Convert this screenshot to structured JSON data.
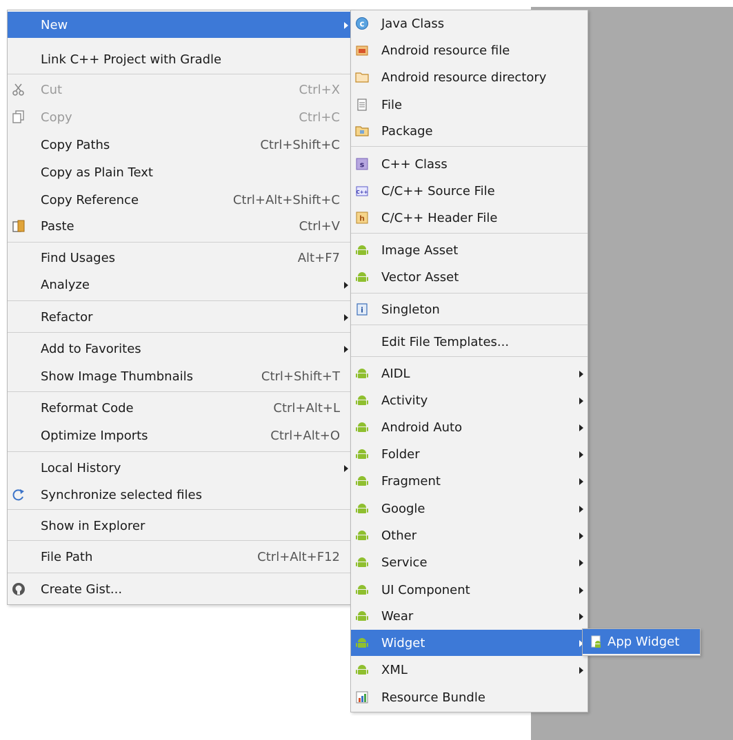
{
  "colors": {
    "selection": "#3d79d7",
    "menu_bg": "#f2f2f2",
    "android_green": "#8fbf2f",
    "disabled_text": "#9a9a9a"
  },
  "main_menu": [
    {
      "label": "New",
      "shortcut": "",
      "submenu": true,
      "selected": true,
      "icon": ""
    },
    {
      "label": "Link C++ Project with Gradle",
      "shortcut": "",
      "icon": ""
    },
    {
      "label": "Cut",
      "shortcut": "Ctrl+X",
      "disabled": true,
      "icon": "scissors-icon"
    },
    {
      "label": "Copy",
      "shortcut": "Ctrl+C",
      "disabled": true,
      "icon": "copy-icon"
    },
    {
      "label": "Copy Paths",
      "shortcut": "Ctrl+Shift+C",
      "icon": ""
    },
    {
      "label": "Copy as Plain Text",
      "shortcut": "",
      "icon": ""
    },
    {
      "label": "Copy Reference",
      "shortcut": "Ctrl+Alt+Shift+C",
      "icon": ""
    },
    {
      "label": "Paste",
      "shortcut": "Ctrl+V",
      "icon": "paste-icon"
    },
    {
      "label": "Find Usages",
      "shortcut": "Alt+F7",
      "icon": ""
    },
    {
      "label": "Analyze",
      "shortcut": "",
      "submenu": true,
      "icon": ""
    },
    {
      "label": "Refactor",
      "shortcut": "",
      "submenu": true,
      "icon": ""
    },
    {
      "label": "Add to Favorites",
      "shortcut": "",
      "submenu": true,
      "icon": ""
    },
    {
      "label": "Show Image Thumbnails",
      "shortcut": "Ctrl+Shift+T",
      "icon": ""
    },
    {
      "label": "Reformat Code",
      "shortcut": "Ctrl+Alt+L",
      "icon": ""
    },
    {
      "label": "Optimize Imports",
      "shortcut": "Ctrl+Alt+O",
      "icon": ""
    },
    {
      "label": "Local History",
      "shortcut": "",
      "submenu": true,
      "icon": ""
    },
    {
      "label": "Synchronize selected files",
      "shortcut": "",
      "icon": "sync-icon"
    },
    {
      "label": "Show in Explorer",
      "shortcut": "",
      "icon": ""
    },
    {
      "label": "File Path",
      "shortcut": "Ctrl+Alt+F12",
      "icon": ""
    },
    {
      "label": "Create Gist...",
      "shortcut": "",
      "icon": "github-icon"
    }
  ],
  "new_menu": [
    {
      "label": "Java Class",
      "icon": "java-class-icon"
    },
    {
      "label": "Android resource file",
      "icon": "android-resource-file-icon"
    },
    {
      "label": "Android resource directory",
      "icon": "folder-icon"
    },
    {
      "label": "File",
      "icon": "file-icon"
    },
    {
      "label": "Package",
      "icon": "package-icon"
    },
    {
      "label": "C++ Class",
      "icon": "cpp-class-icon"
    },
    {
      "label": "C/C++ Source File",
      "icon": "cpp-source-icon"
    },
    {
      "label": "C/C++ Header File",
      "icon": "cpp-header-icon"
    },
    {
      "label": "Image Asset",
      "icon": "android-icon"
    },
    {
      "label": "Vector Asset",
      "icon": "android-icon"
    },
    {
      "label": "Singleton",
      "icon": "singleton-icon"
    },
    {
      "label": "Edit File Templates...",
      "icon": ""
    },
    {
      "label": "AIDL",
      "icon": "android-icon",
      "submenu": true
    },
    {
      "label": "Activity",
      "icon": "android-icon",
      "submenu": true
    },
    {
      "label": "Android Auto",
      "icon": "android-icon",
      "submenu": true
    },
    {
      "label": "Folder",
      "icon": "android-icon",
      "submenu": true
    },
    {
      "label": "Fragment",
      "icon": "android-icon",
      "submenu": true
    },
    {
      "label": "Google",
      "icon": "android-icon",
      "submenu": true
    },
    {
      "label": "Other",
      "icon": "android-icon",
      "submenu": true
    },
    {
      "label": "Service",
      "icon": "android-icon",
      "submenu": true
    },
    {
      "label": "UI Component",
      "icon": "android-icon",
      "submenu": true
    },
    {
      "label": "Wear",
      "icon": "android-icon",
      "submenu": true
    },
    {
      "label": "Widget",
      "icon": "android-icon",
      "submenu": true,
      "selected": true
    },
    {
      "label": "XML",
      "icon": "android-icon",
      "submenu": true
    },
    {
      "label": "Resource Bundle",
      "icon": "resource-bundle-icon"
    }
  ],
  "widget_menu": [
    {
      "label": "App Widget",
      "icon": "app-widget-icon",
      "selected": true
    }
  ]
}
